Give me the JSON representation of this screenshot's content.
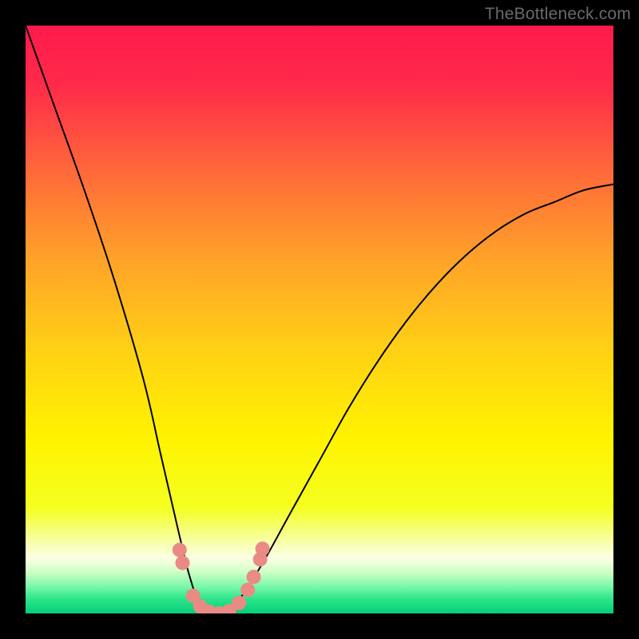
{
  "watermark": "TheBottleneck.com",
  "chart_data": {
    "type": "line",
    "title": "",
    "xlabel": "",
    "ylabel": "",
    "xlim": [
      0,
      1
    ],
    "ylim": [
      0,
      1
    ],
    "series": [
      {
        "name": "curve",
        "x": [
          0.0,
          0.05,
          0.1,
          0.15,
          0.2,
          0.23,
          0.26,
          0.28,
          0.3,
          0.33,
          0.36,
          0.4,
          0.45,
          0.5,
          0.55,
          0.6,
          0.65,
          0.7,
          0.75,
          0.8,
          0.85,
          0.9,
          0.95,
          1.0
        ],
        "y": [
          1.0,
          0.86,
          0.72,
          0.57,
          0.4,
          0.27,
          0.14,
          0.06,
          0.01,
          0.0,
          0.02,
          0.08,
          0.17,
          0.26,
          0.35,
          0.43,
          0.5,
          0.56,
          0.61,
          0.65,
          0.68,
          0.7,
          0.72,
          0.73
        ]
      }
    ],
    "markers": [
      {
        "x": 0.262,
        "y": 0.108
      },
      {
        "x": 0.267,
        "y": 0.086
      },
      {
        "x": 0.285,
        "y": 0.03
      },
      {
        "x": 0.297,
        "y": 0.012
      },
      {
        "x": 0.312,
        "y": 0.003
      },
      {
        "x": 0.329,
        "y": 0.0
      },
      {
        "x": 0.346,
        "y": 0.004
      },
      {
        "x": 0.363,
        "y": 0.018
      },
      {
        "x": 0.378,
        "y": 0.04
      },
      {
        "x": 0.388,
        "y": 0.062
      },
      {
        "x": 0.399,
        "y": 0.092
      },
      {
        "x": 0.403,
        "y": 0.11
      }
    ],
    "background_gradient": {
      "stops": [
        {
          "offset": 0.0,
          "color": "#ff1a4d"
        },
        {
          "offset": 0.1,
          "color": "#ff2a4a"
        },
        {
          "offset": 0.25,
          "color": "#ff6a3a"
        },
        {
          "offset": 0.4,
          "color": "#ffa328"
        },
        {
          "offset": 0.55,
          "color": "#ffd015"
        },
        {
          "offset": 0.7,
          "color": "#fff300"
        },
        {
          "offset": 0.82,
          "color": "#f4ff20"
        },
        {
          "offset": 0.885,
          "color": "#f8ffb8"
        },
        {
          "offset": 0.905,
          "color": "#fdffe4"
        },
        {
          "offset": 0.93,
          "color": "#cdffc5"
        },
        {
          "offset": 0.955,
          "color": "#77f7a8"
        },
        {
          "offset": 0.975,
          "color": "#2de58a"
        },
        {
          "offset": 1.0,
          "color": "#05cf78"
        }
      ]
    },
    "marker_color": "#e98b84",
    "curve_color": "#000000"
  }
}
